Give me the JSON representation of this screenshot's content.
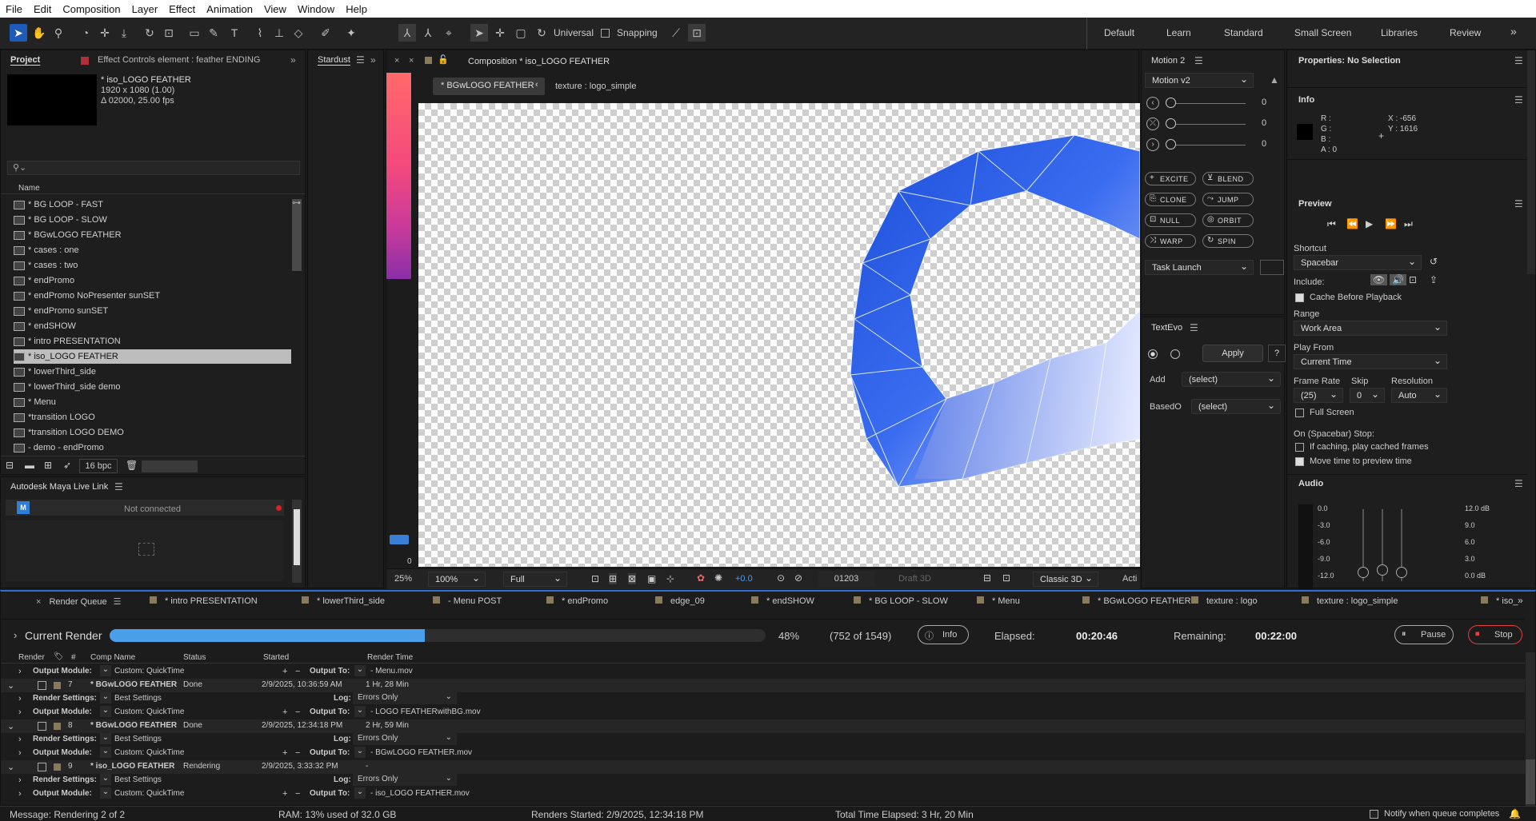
{
  "menu": [
    "File",
    "Edit",
    "Composition",
    "Layer",
    "Effect",
    "Animation",
    "View",
    "Window",
    "Help"
  ],
  "toolbar": {
    "universal": "Universal",
    "snapping": "Snapping"
  },
  "workspaces": [
    "Default",
    "Learn",
    "Standard",
    "Small Screen",
    "Libraries",
    "Review"
  ],
  "project": {
    "tab": "Project",
    "effect_controls": "Effect Controls element : feather ENDING",
    "comp_name": "* iso_LOGO FEATHER",
    "comp_size": "1920 x 1080 (1.00)",
    "comp_dur": "Δ 02000, 25.00 fps",
    "search_placeholder": "⚲⌄",
    "col_name": "Name",
    "items": [
      "* BG LOOP - FAST",
      "* BG LOOP - SLOW",
      "* BGwLOGO FEATHER",
      "* cases : one",
      "* cases : two",
      "* endPromo",
      "* endPromo NoPresenter sunSET",
      "* endPromo sunSET",
      "* endSHOW",
      "* intro PRESENTATION",
      "* iso_LOGO FEATHER",
      "* lowerThird_side",
      "* lowerThird_side demo",
      "* Menu",
      "*transition LOGO",
      "*transition LOGO DEMO",
      "- demo - endPromo"
    ],
    "selected_index": 10,
    "bpc": "16 bpc"
  },
  "maya": {
    "title": "Autodesk Maya Live Link",
    "status": "Not connected"
  },
  "stardust": {
    "title": "Stardust"
  },
  "comp": {
    "tab": "Composition * iso_LOGO FEATHER",
    "crumb1": "* BGwLOGO FEATHER",
    "crumb2": "texture : logo_simple",
    "zoom_small": "25%",
    "zoom": "100%",
    "quality": "Full",
    "exposure": "+0.0",
    "timecode": "01203",
    "draft": "Draft 3D",
    "renderer": "Classic 3D",
    "active": "Acti",
    "frame_small": "0"
  },
  "motion": {
    "title": "Motion 2",
    "version": "Motion v2",
    "values": [
      "0",
      "0",
      "0"
    ],
    "buttons": [
      "EXCITE",
      "BLEND",
      "CLONE",
      "JUMP",
      "NULL",
      "ORBIT",
      "WARP",
      "SPIN"
    ],
    "task": "Task Launch"
  },
  "textevo": {
    "title": "TextEvo",
    "apply": "Apply",
    "help": "?",
    "add_label": "Add",
    "add_value": "(select)",
    "based_label": "BasedO",
    "based_value": "(select)"
  },
  "properties": {
    "title": "Properties: No Selection"
  },
  "info": {
    "title": "Info",
    "r": "R :",
    "g": "G :",
    "b": "B :",
    "a": "A :  0",
    "x": "X : -656",
    "y": "Y : 1616"
  },
  "preview": {
    "title": "Preview",
    "shortcut_label": "Shortcut",
    "shortcut": "Spacebar",
    "include": "Include:",
    "cache": "Cache Before Playback",
    "range_label": "Range",
    "range": "Work Area",
    "playfrom_label": "Play From",
    "playfrom": "Current Time",
    "framerate_label": "Frame Rate",
    "skip_label": "Skip",
    "resolution_label": "Resolution",
    "framerate": "(25)",
    "skip": "0",
    "resolution": "Auto",
    "fullscreen": "Full Screen",
    "stop_label": "On (Spacebar) Stop:",
    "opt1": "If caching, play cached frames",
    "opt2": "Move time to preview time"
  },
  "audio": {
    "title": "Audio",
    "left": [
      "0.0",
      "-3.0",
      "-6.0",
      "-9.0",
      "-12.0"
    ],
    "right": [
      "12.0 dB",
      "9.0",
      "6.0",
      "3.0",
      "0.0 dB"
    ]
  },
  "rq_tabs": [
    "Render Queue",
    "* intro PRESENTATION",
    "* lowerThird_side",
    "- Menu POST",
    "* endPromo",
    "edge_09",
    "* endSHOW",
    "* BG LOOP - SLOW",
    "* Menu",
    "* BGwLOGO FEATHER",
    "texture : logo",
    "texture : logo_simple",
    "* iso_"
  ],
  "render": {
    "current": "Current Render",
    "progress": 0.48,
    "percent": "48%",
    "frames": "(752 of 1549)",
    "info": "Info",
    "elapsed_label": "Elapsed:",
    "elapsed": "00:20:46",
    "remaining_label": "Remaining:",
    "remaining": "00:22:00",
    "pause": "Pause",
    "stop": "Stop",
    "cols": [
      "Render",
      "#",
      "Comp Name",
      "Status",
      "Started",
      "Render Time"
    ],
    "om_label": "Output Module:",
    "rs_label": "Render Settings:",
    "log_label": "Log:",
    "output_label": "Output To:",
    "om_value": "Custom: QuickTime",
    "rs_value": "Best Settings",
    "log_value": "Errors Only",
    "out0": "- Menu.mov",
    "jobs": [
      {
        "num": "7",
        "name": "* BGwLOGO FEATHER",
        "status": "Done",
        "started": "2/9/2025, 10:36:59 AM",
        "time": "1 Hr, 28 Min",
        "out": "- LOGO FEATHERwithBG.mov"
      },
      {
        "num": "8",
        "name": "* BGwLOGO FEATHER",
        "status": "Done",
        "started": "2/9/2025, 12:34:18 PM",
        "time": "2 Hr, 59 Min",
        "out": "- BGwLOGO FEATHER.mov"
      },
      {
        "num": "9",
        "name": "* iso_LOGO FEATHER",
        "status": "Rendering",
        "started": "2/9/2025, 3:33:32 PM",
        "time": "-",
        "out": "- iso_LOGO FEATHER.mov"
      }
    ]
  },
  "status": {
    "message": "Message:  Rendering 2 of 2",
    "ram": "RAM:  13% used of 32.0 GB",
    "started": "Renders Started:  2/9/2025, 12:34:18 PM",
    "total": "Total Time Elapsed:  3 Hr, 20 Min",
    "notify": "Notify when queue completes"
  },
  "colors": {
    "accent": "#2f80ed",
    "progress": "#4b9eea",
    "selected": "#bdbdbd"
  }
}
